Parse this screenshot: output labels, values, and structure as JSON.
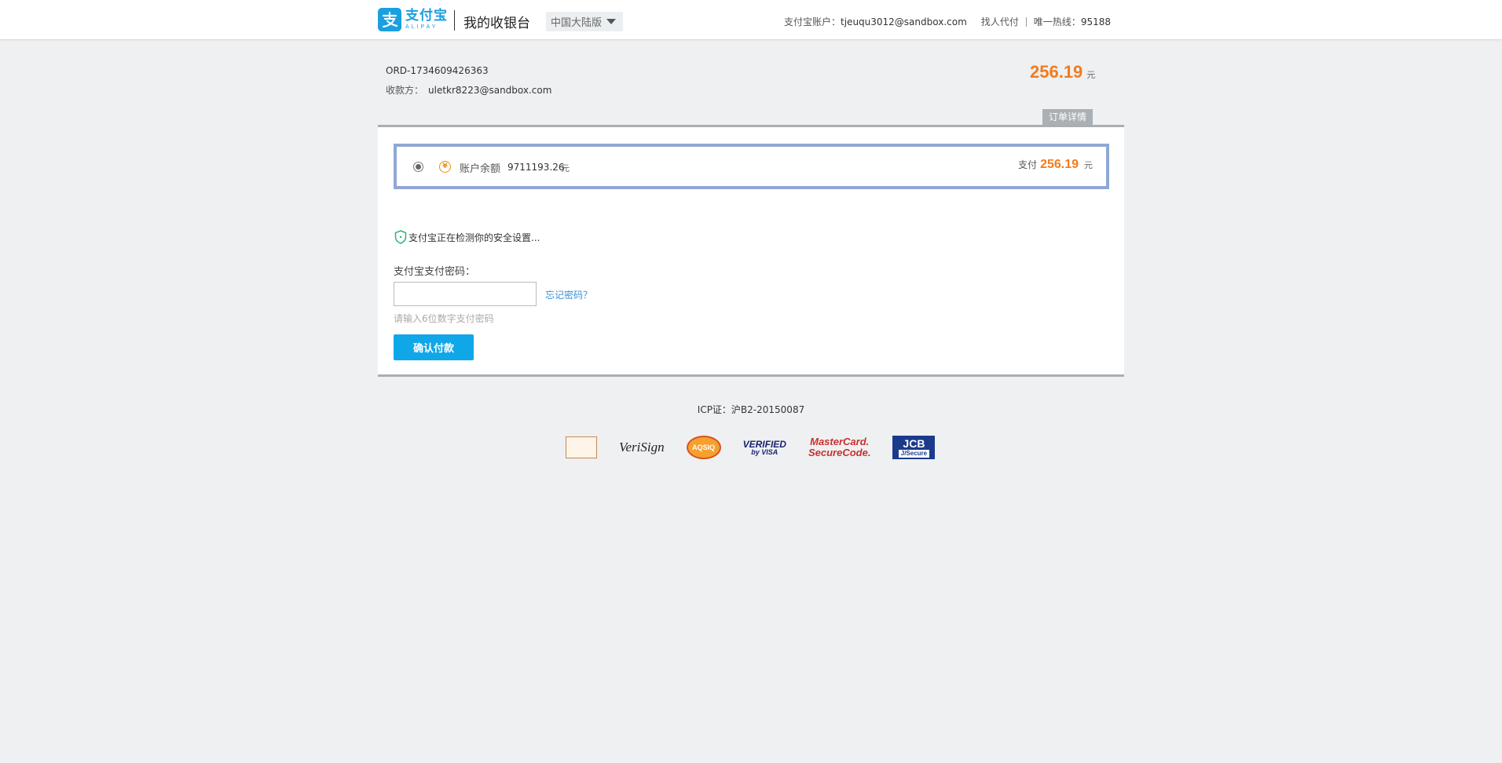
{
  "header": {
    "logo_cn": "支付宝",
    "logo_en": "ALIPAY",
    "title": "我的收银台",
    "region": "中国大陆版",
    "account_label": "支付宝账户：",
    "account_value": "tjeuqu3012@sandbox.com",
    "find_payer": "找人代付",
    "hotline_label": "唯一热线：",
    "hotline_value": "95188"
  },
  "order": {
    "id": "ORD-1734609426363",
    "payee_label": "收款方：",
    "payee_value": "uletkr8223@sandbox.com",
    "amount": "256.19",
    "currency_unit": "元",
    "detail_tab": "订单详情"
  },
  "payment": {
    "method_label": "账户余额",
    "balance": "9711193.26",
    "balance_unit": "元",
    "pay_label": "支付",
    "pay_amount": "256.19",
    "pay_unit": "元",
    "icon_char": "¥"
  },
  "security": {
    "checking_text": "支付宝正在检测你的安全设置..."
  },
  "password": {
    "label": "支付宝支付密码：",
    "value": "",
    "forgot": "忘记密码？",
    "hint": "请输入6位数字支付密码",
    "confirm": "确认付款"
  },
  "footer": {
    "icp": "ICP证：沪B2-20150087",
    "badges": {
      "verisign": "VeriSign",
      "sec": "AQSIQ",
      "visa_1": "VERIFIED",
      "visa_2": "by VISA",
      "mc_1": "MasterCard.",
      "mc_2": "SecureCode.",
      "jcb_1": "JCB",
      "jcb_2": "J/Secure"
    }
  },
  "colors": {
    "brand": "#1a9fe0",
    "amount": "#f37b1d",
    "selected_border": "#8fa8d4",
    "button": "#10a7e9",
    "link": "#3d8fd6"
  }
}
